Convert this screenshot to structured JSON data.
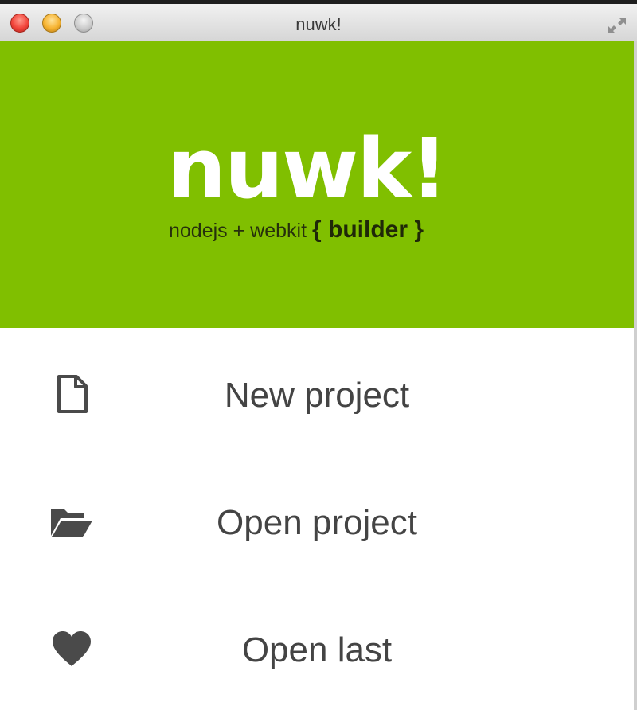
{
  "window": {
    "title": "nuwk!"
  },
  "banner": {
    "logo_text": "nuwk!",
    "tagline_prefix": "nodejs + webkit",
    "tagline_bold": "{ builder }",
    "color": "#80bf00"
  },
  "menu": {
    "items": [
      {
        "label": "New project",
        "icon": "file-icon"
      },
      {
        "label": "Open project",
        "icon": "folder-open-icon"
      },
      {
        "label": "Open last",
        "icon": "heart-icon"
      }
    ]
  }
}
